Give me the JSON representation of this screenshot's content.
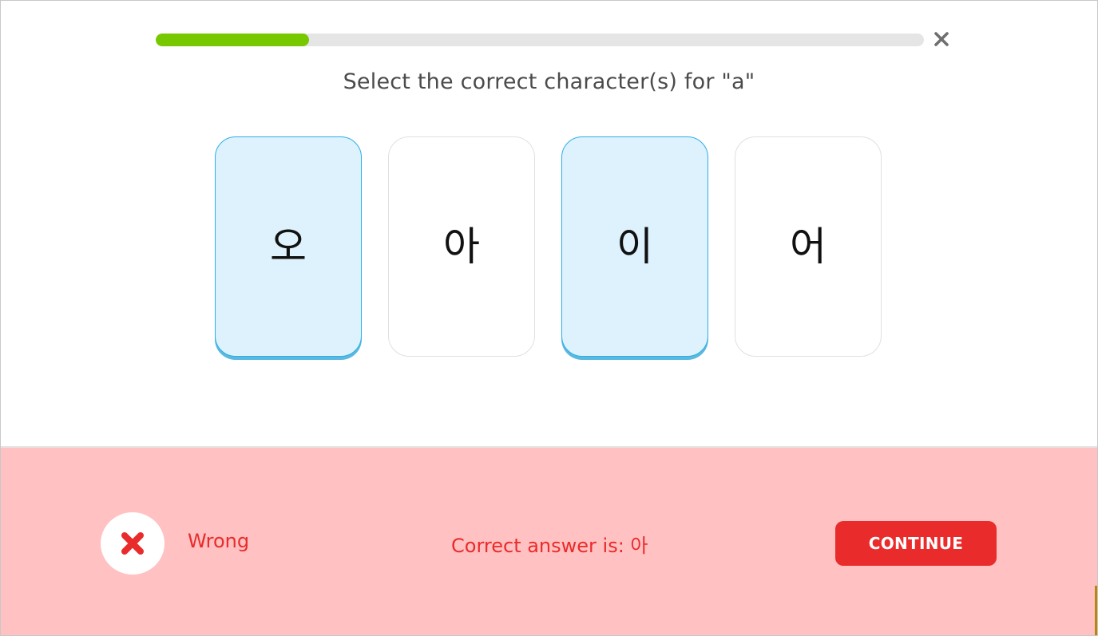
{
  "header": {
    "progress_fraction": 0.2,
    "progress_color": "#78c800",
    "close_icon": "close-icon"
  },
  "question": {
    "prompt": "Select the correct character(s) for \"a\""
  },
  "choices": [
    {
      "glyph": "오",
      "selected": true
    },
    {
      "glyph": "아",
      "selected": false
    },
    {
      "glyph": "이",
      "selected": true
    },
    {
      "glyph": "어",
      "selected": false
    }
  ],
  "feedback": {
    "status_icon": "x-icon",
    "status_label": "Wrong",
    "answer_text": "Correct answer is: 아",
    "continue_label": "CONTINUE",
    "accent_color": "#ea2b2b",
    "background_color": "#ffc1c1"
  }
}
